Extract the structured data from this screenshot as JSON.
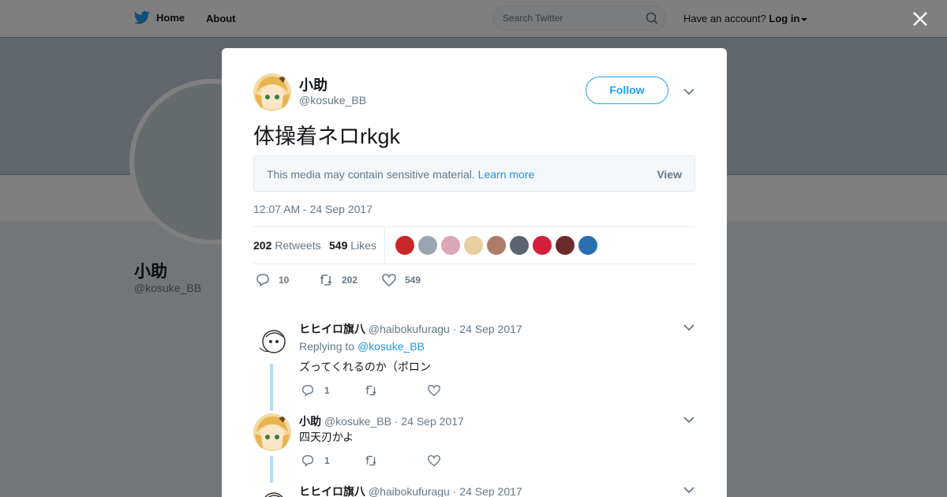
{
  "topbar": {
    "home_label": "Home",
    "about_label": "About",
    "search_placeholder": "Search Twitter",
    "account_prompt": "Have an account?",
    "login_label": "Log in"
  },
  "profile": {
    "name": "小助",
    "handle": "@kosuke_BB"
  },
  "tweet": {
    "author_name": "小助",
    "author_handle": "@kosuke_BB",
    "follow_label": "Follow",
    "text": "体操着ネロrkgk",
    "sensitive_message": "This media may contain sensitive material.",
    "sensitive_link": "Learn more",
    "sensitive_view": "View",
    "timestamp": "12:07 AM - 24 Sep 2017",
    "retweets_count": "202",
    "retweets_label": "Retweets",
    "likes_count": "549",
    "likes_label": "Likes",
    "reply_count": "10",
    "retweet_action_count": "202",
    "like_action_count": "549"
  },
  "likers": [
    "#c62828",
    "#9aa5b1",
    "#d9a7b8",
    "#e8cfa0",
    "#b07a6a",
    "#5d6470",
    "#d21f3c",
    "#6b2a2a",
    "#2a6fb0"
  ],
  "replies": [
    {
      "name": "ヒヒイロ旗八",
      "handle": "@haibokufuragu",
      "date": "· 24 Sep 2017",
      "replying_prefix": "Replying to",
      "replying_to": "@kosuke_BB",
      "text": "ズってくれるのか（ポロン",
      "reply_count": "1"
    },
    {
      "name": "小助",
      "handle": "@kosuke_BB",
      "date": "· 24 Sep 2017",
      "text": "四天刃かよ",
      "reply_count": "1"
    },
    {
      "name": "ヒヒイロ旗八",
      "handle": "@haibokufuragu",
      "date": "· 24 Sep 2017"
    }
  ],
  "colors": {
    "accent": "#1da1f2",
    "link": "#1b95e0",
    "thread_line": "#b8dbf5"
  }
}
